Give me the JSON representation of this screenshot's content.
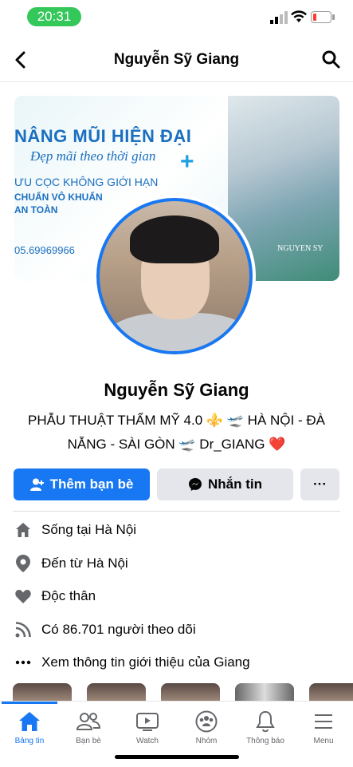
{
  "status_bar": {
    "time": "20:31"
  },
  "header": {
    "title": "Nguyễn Sỹ Giang"
  },
  "cover": {
    "line1": "NÂNG MŨI HIỆN ĐẠI",
    "line2": "Đẹp mãi theo thời gian",
    "line3": "ƯU CỌC KHÔNG GIỚI HẠN",
    "line4": "CHUẨN VÔ KHUẨN",
    "line5": "AN TOÀN",
    "line6": "05.69969966",
    "line7": "NGUYEN SY"
  },
  "profile": {
    "name": "Nguyễn Sỹ Giang",
    "bio_line1": "PHẪU THUẬT THẨM MỸ 4.0 ⚜️ 🛫 HÀ NỘI - ĐÀ",
    "bio_line2": "NẴNG - SÀI GÒN 🛫 Dr_GIANG ❤️"
  },
  "actions": {
    "add_friend": "Thêm bạn bè",
    "message": "Nhắn tin",
    "more": "···"
  },
  "info": [
    {
      "text": "Sống tại Hà Nội",
      "icon": "home-icon"
    },
    {
      "text": "Đến từ Hà Nội",
      "icon": "location-pin-icon"
    },
    {
      "text": "Độc thân",
      "icon": "heart-icon"
    },
    {
      "text": "Có 86.701 người theo dõi",
      "icon": "rss-icon"
    },
    {
      "text": "Xem thông tin giới thiệu của Giang",
      "icon": "more-dots-icon"
    }
  ],
  "tabs": [
    {
      "label": "Bảng tin",
      "icon": "home-icon",
      "active": true
    },
    {
      "label": "Bạn bè",
      "icon": "friends-icon"
    },
    {
      "label": "Watch",
      "icon": "watch-icon"
    },
    {
      "label": "Nhóm",
      "icon": "groups-icon"
    },
    {
      "label": "Thông báo",
      "icon": "bell-icon"
    },
    {
      "label": "Menu",
      "icon": "menu-icon"
    }
  ],
  "colors": {
    "accent": "#1877f2",
    "button_gray": "#e4e6eb",
    "icon_gray": "#65676b"
  }
}
